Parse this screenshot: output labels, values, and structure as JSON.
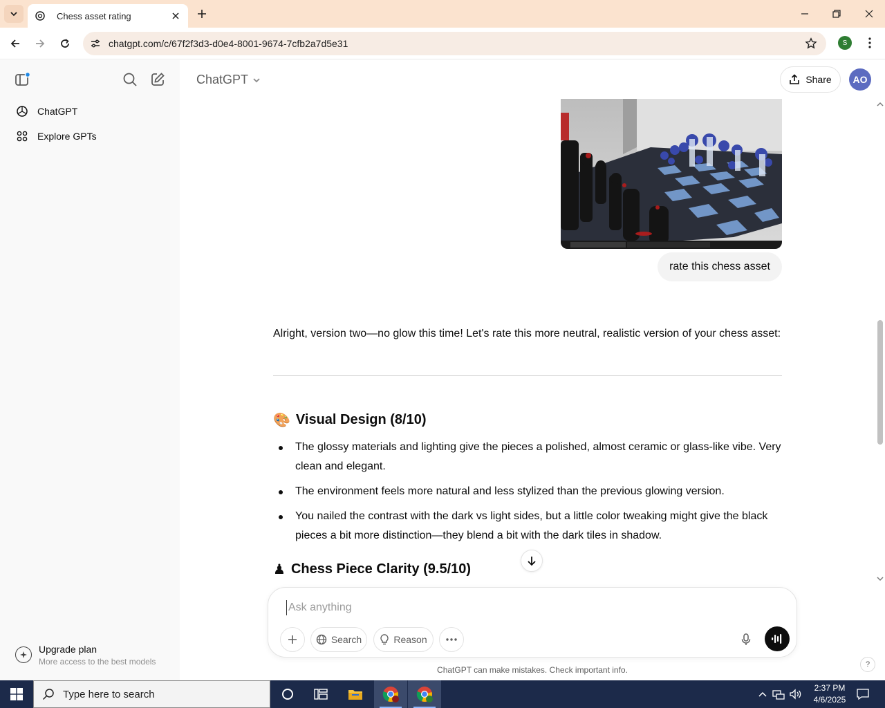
{
  "browser": {
    "tab_title": "Chess asset rating",
    "url": "chatgpt.com/c/67f2f3d3-d0e4-8001-9674-7cfb2a7d5e31",
    "profile_initial": "S"
  },
  "sidebar": {
    "items": [
      {
        "label": "ChatGPT",
        "icon": "openai-logo-icon"
      },
      {
        "label": "Explore GPTs",
        "icon": "grid-icon"
      }
    ],
    "upgrade": {
      "title": "Upgrade plan",
      "subtitle": "More access to the best models"
    }
  },
  "header": {
    "model": "ChatGPT",
    "share_label": "Share",
    "avatar_initials": "AO"
  },
  "conversation": {
    "user_message": "rate this chess asset",
    "assistant_intro": "Alright, version two—no glow this time! Let's rate this more neutral, realistic version of your chess asset:",
    "sections": [
      {
        "emoji": "🎨",
        "heading": "Visual Design (8/10)",
        "bullets": [
          "The glossy materials and lighting give the pieces a polished, almost ceramic or glass-like vibe. Very clean and elegant.",
          "The environment feels more natural and less stylized than the previous glowing version.",
          "You nailed the contrast with the dark vs light sides, but a little color tweaking might give the black pieces a bit more distinction—they blend a bit with the dark tiles in shadow."
        ]
      },
      {
        "emoji": "♟",
        "heading": "Chess Piece Clarity (9.5/10)"
      }
    ]
  },
  "composer": {
    "placeholder": "Ask anything",
    "search_label": "Search",
    "reason_label": "Reason",
    "disclaimer": "ChatGPT can make mistakes. Check important info."
  },
  "taskbar": {
    "search_placeholder": "Type here to search",
    "time": "2:37 PM",
    "date": "4/6/2025"
  },
  "colors": {
    "tabstrip": "#fbe3cf",
    "sidebar": "#f9f9f9",
    "taskbar": "#1c2a4a",
    "avatar": "#5c6bc0"
  }
}
